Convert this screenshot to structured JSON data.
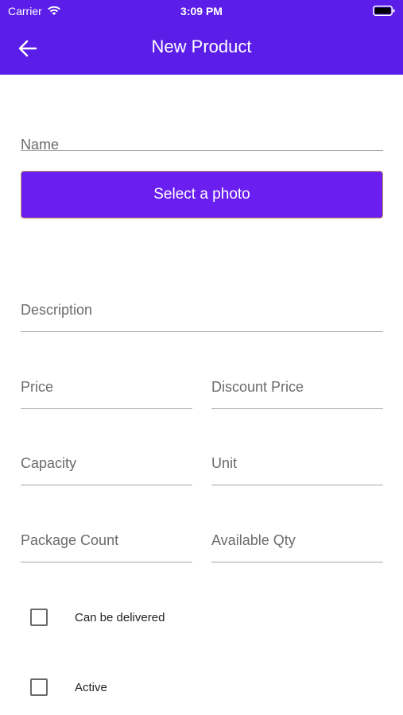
{
  "status_bar": {
    "carrier": "Carrier",
    "time": "3:09 PM"
  },
  "header": {
    "title": "New Product"
  },
  "form": {
    "name_label": "Name",
    "photo_button": "Select a photo",
    "description_label": "Description",
    "price_label": "Price",
    "discount_price_label": "Discount Price",
    "capacity_label": "Capacity",
    "unit_label": "Unit",
    "package_count_label": "Package Count",
    "available_qty_label": "Available Qty",
    "can_be_delivered_label": "Can be delivered",
    "active_label": "Active"
  },
  "colors": {
    "header": "#5a1ee8",
    "button": "#6a1ff0"
  }
}
